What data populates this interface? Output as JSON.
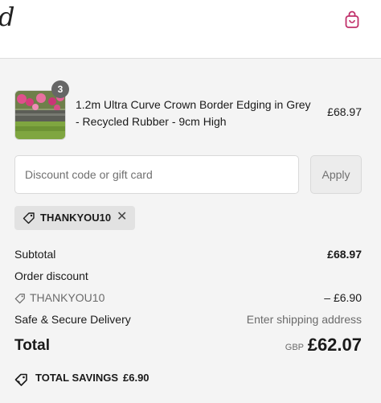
{
  "header": {
    "logo_text": "d",
    "cart_icon": "shopping-bag-icon",
    "accent_color": "#c0306a"
  },
  "line_item": {
    "quantity": "3",
    "title": "1.2m Ultra Curve Crown Border Edging in Grey - Recycled Rubber - 9cm High",
    "price": "£68.97"
  },
  "discount": {
    "placeholder": "Discount code or gift card",
    "apply_label": "Apply",
    "applied_code": "THANKYOU10",
    "remove_icon": "close-icon"
  },
  "summary": {
    "subtotal_label": "Subtotal",
    "subtotal_value": "£68.97",
    "order_discount_label": "Order discount",
    "discount_code": "THANKYOU10",
    "discount_value": "– £6.90",
    "delivery_label": "Safe & Secure Delivery",
    "delivery_value": "Enter shipping address",
    "total_label": "Total",
    "currency": "GBP",
    "total_value": "£62.07",
    "savings_label": "TOTAL SAVINGS",
    "savings_value": "£6.90"
  }
}
